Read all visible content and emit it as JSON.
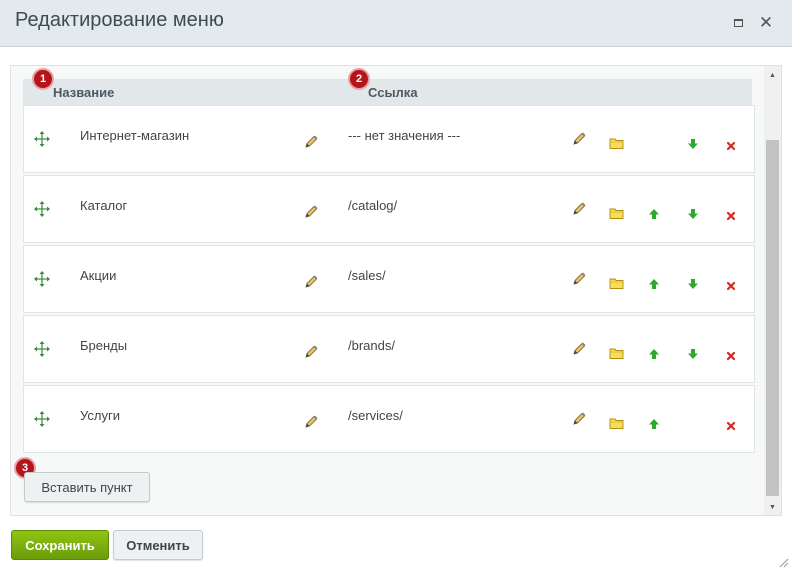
{
  "window": {
    "title": "Редактирование меню"
  },
  "table": {
    "header_name": "Название",
    "header_link": "Ссылка",
    "rows": [
      {
        "name": "Интернет-магазин",
        "link": "--- нет значения ---",
        "up": false,
        "down": true
      },
      {
        "name": "Каталог",
        "link": "/catalog/",
        "up": true,
        "down": true
      },
      {
        "name": "Акции",
        "link": "/sales/",
        "up": true,
        "down": true
      },
      {
        "name": "Бренды",
        "link": "/brands/",
        "up": true,
        "down": true
      },
      {
        "name": "Услуги",
        "link": "/services/",
        "up": true,
        "down": false
      }
    ]
  },
  "badges": [
    "1",
    "2",
    "3"
  ],
  "buttons": {
    "insert": "Вставить пункт",
    "save": "Сохранить",
    "cancel": "Отменить"
  },
  "icons": {
    "drag": "move-arrows-icon",
    "edit": "pencil-icon",
    "folder": "folder-icon",
    "up": "arrow-up-icon",
    "down": "arrow-down-icon",
    "delete": "delete-x-icon"
  },
  "colors": {
    "accent_green": "#6a9c0a",
    "badge_red": "#b3151b",
    "delete_red": "#d42a1e",
    "arrow_green": "#2ea82e"
  }
}
